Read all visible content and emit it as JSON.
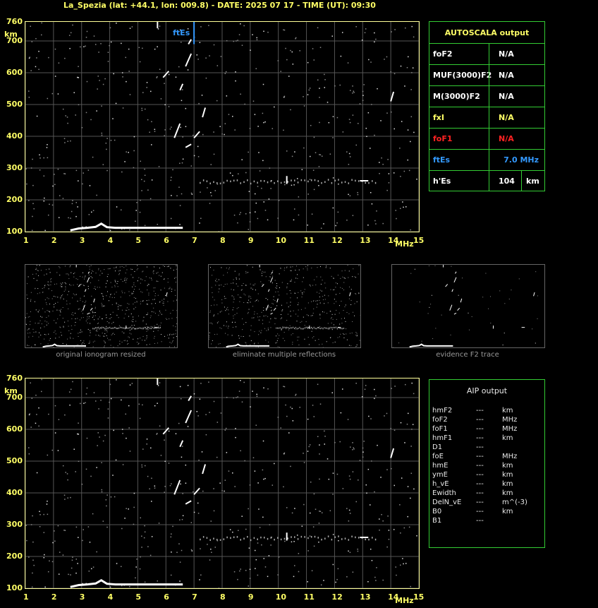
{
  "header": {
    "title": "La_Spezia (lat: +44.1, lon: 009.8) - DATE: 2025 07 17 - TIME (UT): 09:30"
  },
  "ionogram_axes": {
    "y_unit": "km",
    "x_unit": "MHz",
    "y_ticks": [
      "760",
      "700",
      "600",
      "500",
      "400",
      "300",
      "200",
      "100"
    ],
    "x_ticks": [
      "1",
      "2",
      "3",
      "4",
      "5",
      "6",
      "7",
      "8",
      "9",
      "10",
      "11",
      "12",
      "13",
      "14",
      "15"
    ],
    "marker_label": "ftEs"
  },
  "autoscala": {
    "title": "AUTOSCALA output",
    "rows": [
      {
        "label": "foF2",
        "value": "N/A",
        "color": "#ffffff"
      },
      {
        "label": "MUF(3000)F2",
        "value": "N/A",
        "color": "#ffffff"
      },
      {
        "label": "M(3000)F2",
        "value": "N/A",
        "color": "#ffffff"
      },
      {
        "label": "fxI",
        "value": "N/A",
        "color": "#ffff66"
      },
      {
        "label": "foF1",
        "value": "N/A",
        "color": "#ff2222"
      },
      {
        "label": "ftEs",
        "value": "7.0 MHz",
        "color": "#3399ff"
      },
      {
        "label": "h'Es",
        "value": "104",
        "unit": "km",
        "color": "#ffffff"
      }
    ]
  },
  "thumbnails": {
    "captions": [
      "original ionogram resized",
      "eliminate multiple reflections",
      "evidence F2 trace"
    ]
  },
  "aip": {
    "title": "AIP output",
    "rows": [
      {
        "param": "hmF2",
        "value": "---",
        "unit": "km"
      },
      {
        "param": "foF2",
        "value": "---",
        "unit": "MHz"
      },
      {
        "param": "foF1",
        "value": "---",
        "unit": "MHz"
      },
      {
        "param": "hmF1",
        "value": "---",
        "unit": "km"
      },
      {
        "param": "D1",
        "value": "---",
        "unit": ""
      },
      {
        "param": "foE",
        "value": "---",
        "unit": "MHz"
      },
      {
        "param": "hmE",
        "value": "---",
        "unit": "km"
      },
      {
        "param": "ymE",
        "value": "---",
        "unit": "km"
      },
      {
        "param": "h_vE",
        "value": "---",
        "unit": "km"
      },
      {
        "param": "Ewidth",
        "value": "---",
        "unit": "km"
      },
      {
        "param": "DelN_vE",
        "value": "---",
        "unit": "m^(-3)"
      },
      {
        "param": "B0",
        "value": "---",
        "unit": "km"
      },
      {
        "param": "B1",
        "value": "---",
        "unit": ""
      }
    ]
  },
  "colors": {
    "axis_text": "#ffff66",
    "plot_border": "#ffff99",
    "grid": "#555555",
    "panel_border": "#33cc33",
    "panel_title": "#ffff66",
    "trace": "#ffffff",
    "marker": "#3399ff"
  },
  "chart_data": [
    {
      "type": "scatter",
      "xlabel": "MHz",
      "ylabel": "km",
      "xlim": [
        1,
        15
      ],
      "ylim": [
        100,
        760
      ],
      "grid": true,
      "marker": {
        "label": "ftEs",
        "x": 7.0
      },
      "es_trace": [
        [
          2.6,
          104
        ],
        [
          2.9,
          110
        ],
        [
          3.2,
          112
        ],
        [
          3.5,
          115
        ],
        [
          3.7,
          125
        ],
        [
          3.9,
          114
        ],
        [
          4.2,
          112
        ],
        [
          4.6,
          112
        ],
        [
          5.0,
          112
        ],
        [
          5.5,
          112
        ],
        [
          6.0,
          112
        ],
        [
          6.6,
          112
        ]
      ],
      "reflection_traces": [
        [
          [
            5.9,
            585
          ],
          [
            6.1,
            605
          ]
        ],
        [
          [
            6.5,
            545
          ],
          [
            6.6,
            565
          ]
        ],
        [
          [
            6.7,
            620
          ],
          [
            6.9,
            660
          ]
        ],
        [
          [
            6.8,
            690
          ],
          [
            6.9,
            705
          ]
        ],
        [
          [
            6.3,
            395
          ],
          [
            6.5,
            440
          ]
        ],
        [
          [
            6.7,
            365
          ],
          [
            6.9,
            375
          ]
        ],
        [
          [
            7.3,
            460
          ],
          [
            7.4,
            490
          ]
        ],
        [
          [
            7.0,
            395
          ],
          [
            7.2,
            415
          ]
        ],
        [
          [
            5.7,
            740
          ],
          [
            5.7,
            760
          ]
        ],
        [
          [
            10.3,
            250
          ],
          [
            10.3,
            275
          ]
        ],
        [
          [
            12.9,
            260
          ],
          [
            13.2,
            260
          ]
        ],
        [
          [
            14.0,
            510
          ],
          [
            14.1,
            540
          ]
        ]
      ],
      "es_multiple_band": {
        "x": [
          7.2,
          13.5
        ],
        "y": 260
      }
    }
  ]
}
